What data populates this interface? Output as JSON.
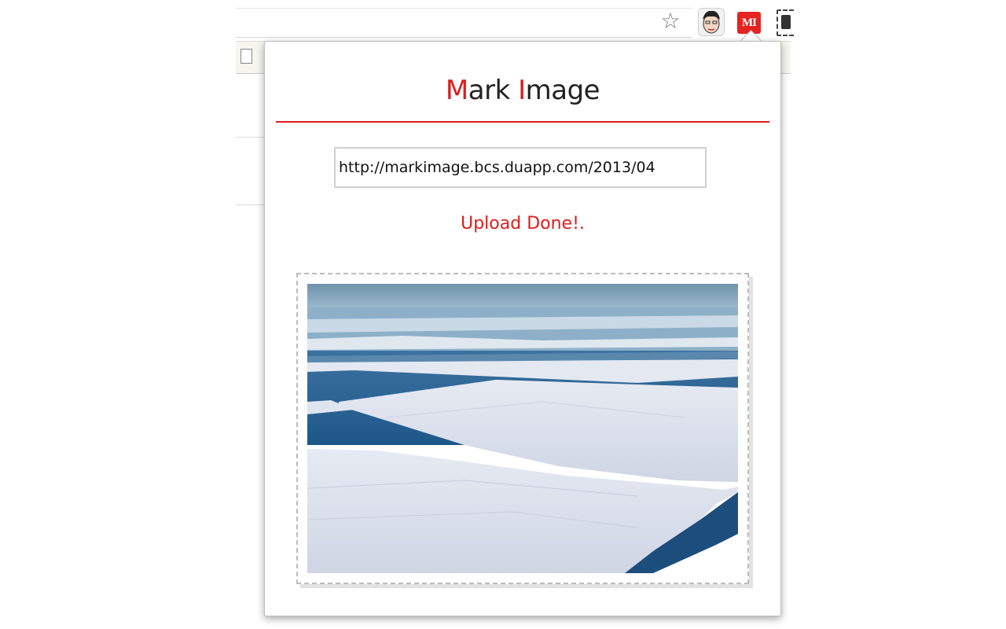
{
  "toolbar": {
    "star_icon": "star-outline-icon",
    "extensions": [
      {
        "name": "avatar-extension-icon"
      },
      {
        "name": "mark-image-extension-icon",
        "label": "MI",
        "color": "#e52320"
      },
      {
        "name": "puzzle-extension-icon"
      }
    ]
  },
  "popup": {
    "title_initial_1": "M",
    "title_rest_1": "ark ",
    "title_initial_2": "I",
    "title_rest_2": "mage",
    "url_value": "http://markimage.bcs.duapp.com/2013/04",
    "status": "Upload Done!.",
    "accent_color": "#e01b1b",
    "image_alt": "Aerial view of sea ice floes with dark blue water channels"
  }
}
